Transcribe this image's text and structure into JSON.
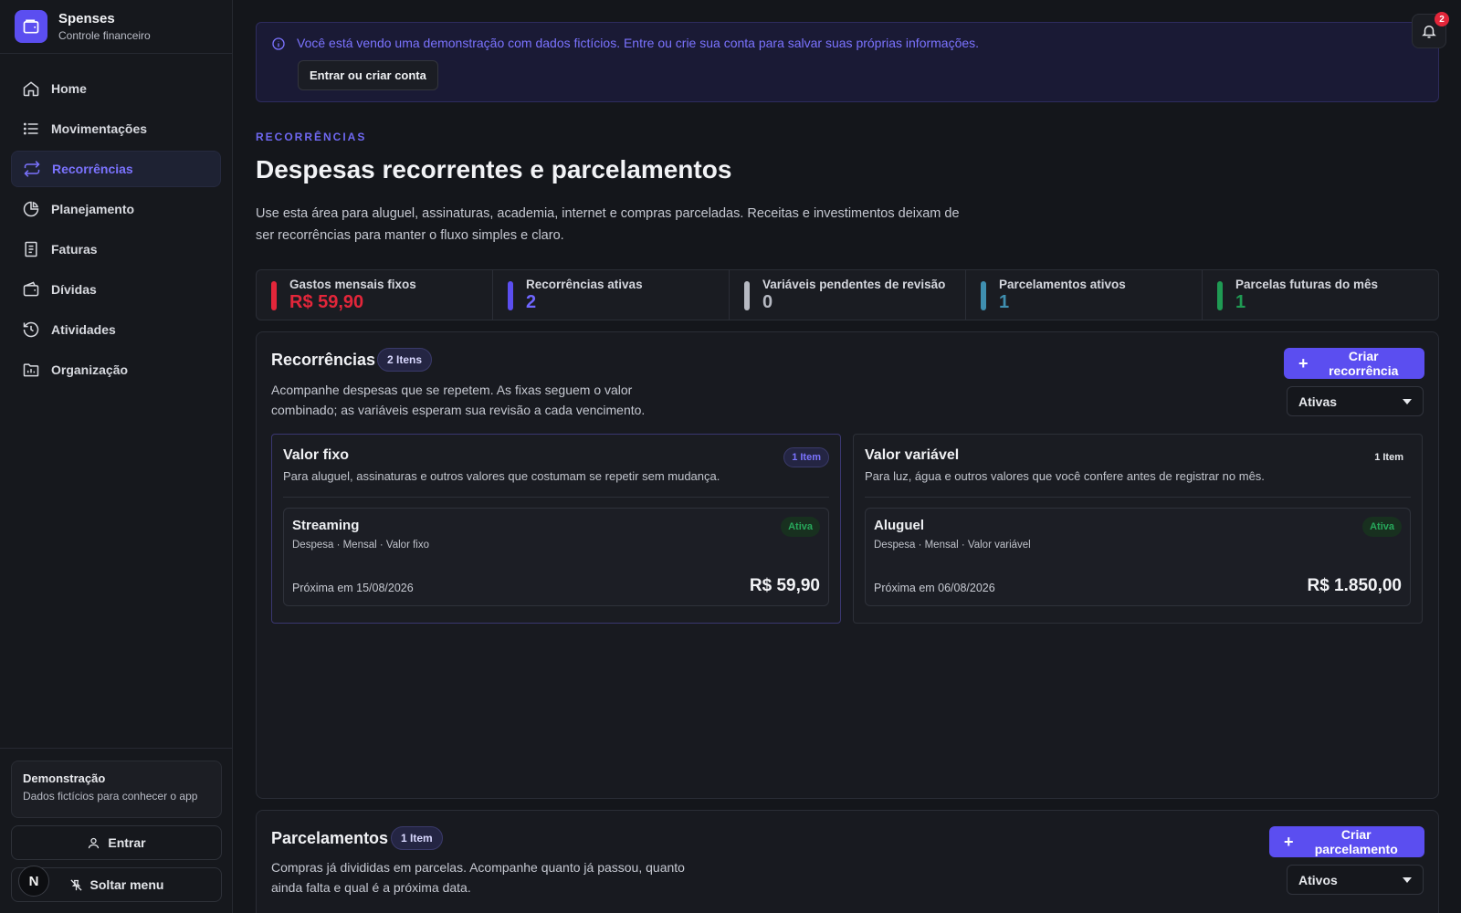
{
  "app": {
    "name": "Spenses",
    "subtitle": "Controle financeiro"
  },
  "nav": [
    {
      "label": "Home",
      "icon": "home-icon",
      "active": false
    },
    {
      "label": "Movimentações",
      "icon": "list-icon",
      "active": false
    },
    {
      "label": "Recorrências",
      "icon": "repeat-icon",
      "active": true
    },
    {
      "label": "Planejamento",
      "icon": "pie-icon",
      "active": false
    },
    {
      "label": "Faturas",
      "icon": "receipt-icon",
      "active": false
    },
    {
      "label": "Dívidas",
      "icon": "wallet-icon",
      "active": false
    },
    {
      "label": "Atividades",
      "icon": "history-icon",
      "active": false
    },
    {
      "label": "Organização",
      "icon": "folder-icon",
      "active": false
    }
  ],
  "demo": {
    "title": "Demonstração",
    "subtitle": "Dados fictícios para conhecer o app"
  },
  "sidebar_actions": {
    "login": "Entrar",
    "unpin": "Soltar menu"
  },
  "n_badge": "N",
  "banner": {
    "text": "Você está vendo uma demonstração com dados fictícios. Entre ou crie sua conta para salvar suas próprias informações.",
    "button": "Entrar ou criar conta"
  },
  "notifications": {
    "count": "2"
  },
  "page": {
    "kicker": "RECORRÊNCIAS",
    "title": "Despesas recorrentes e parcelamentos",
    "description": "Use esta área para aluguel, assinaturas, academia, internet e compras parceladas. Receitas e investimentos deixam de ser recorrências para manter o fluxo simples e claro."
  },
  "stats": [
    {
      "label": "Gastos mensais fixos",
      "value": "R$ 59,90",
      "color": "#e3263a"
    },
    {
      "label": "Recorrências ativas",
      "value": "2",
      "color": "#5b4ef0"
    },
    {
      "label": "Variáveis pendentes de revisão",
      "value": "0",
      "color": "#b6b9c2"
    },
    {
      "label": "Parcelamentos ativos",
      "value": "1",
      "color": "#3f8fb0"
    },
    {
      "label": "Parcelas futuras do mês",
      "value": "1",
      "color": "#1f9a53"
    }
  ],
  "recurrences": {
    "title": "Recorrências",
    "count": "2 Itens",
    "description": "Acompanhe despesas que se repetem. As fixas seguem o valor combinado; as variáveis esperam sua revisão a cada vencimento.",
    "create_button": "Criar recorrência",
    "filter": "Ativas",
    "groups": [
      {
        "title": "Valor fixo",
        "count": "1 Item",
        "description": "Para aluguel, assinaturas e outros valores que costumam se repetir sem mudança.",
        "item": {
          "name": "Streaming",
          "status": "Ativa",
          "meta": "Despesa · Mensal · Valor fixo",
          "next": "Próxima em 15/08/2026",
          "amount": "R$ 59,90"
        }
      },
      {
        "title": "Valor variável",
        "count": "1 Item",
        "description": "Para luz, água e outros valores que você confere antes de registrar no mês.",
        "item": {
          "name": "Aluguel",
          "status": "Ativa",
          "meta": "Despesa · Mensal · Valor variável",
          "next": "Próxima em 06/08/2026",
          "amount": "R$ 1.850,00"
        }
      }
    ]
  },
  "installments": {
    "title": "Parcelamentos",
    "count": "1 Item",
    "description": "Compras já divididas em parcelas. Acompanhe quanto já passou, quanto ainda falta e qual é a próxima data.",
    "create_button": "Criar parcelamento",
    "filter": "Ativos"
  }
}
